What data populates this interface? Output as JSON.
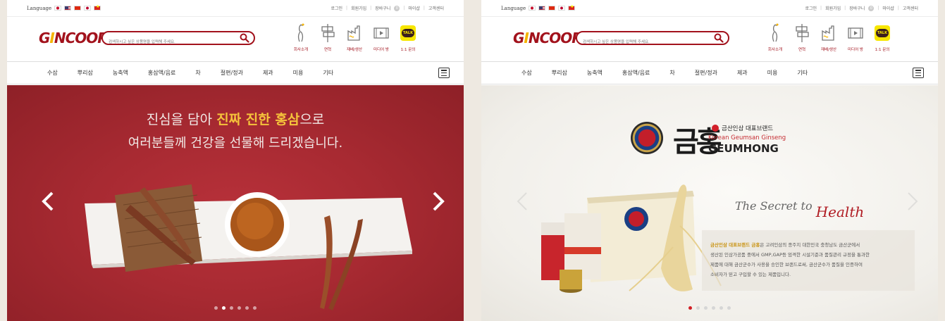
{
  "topbar": {
    "language_label": "Language",
    "links": [
      "로그인",
      "회원가입",
      "장바구니",
      "마이샵",
      "고객센터"
    ],
    "cart_count": "0"
  },
  "header": {
    "logo_text_before": "G",
    "logo_leaf": "I",
    "logo_text_after": "NCOOP",
    "search_placeholder": "검색하시고 싶은 상품명을 입력해 주세요.",
    "icons": [
      {
        "label": "회사소개",
        "icon": "ginseng-root-icon"
      },
      {
        "label": "연혁",
        "icon": "signpost-icon"
      },
      {
        "label": "재배/생산",
        "icon": "factory-icon"
      },
      {
        "label": "미디어 방",
        "icon": "film-play-icon"
      },
      {
        "label": "1:1 문의",
        "icon": "kakao-talk-icon",
        "badge": "TALK"
      }
    ]
  },
  "menu": {
    "items": [
      "수삼",
      "뿌리삼",
      "농축액",
      "홍삼액/음료",
      "차",
      "절편/정과",
      "제과",
      "미용",
      "기타"
    ]
  },
  "slide_left": {
    "line1_pre": "진심을 담아 ",
    "line1_highlight": "진짜 진한 홍삼",
    "line1_post": "으로",
    "line2": "여러분들께 건강을 선물해 드리겠습니다.",
    "dots": 6,
    "active_dot": 1
  },
  "slide_right": {
    "brand_han": "금홍",
    "brand_sub1": "금산인삼 대표브랜드",
    "brand_sub2": "Korean Geumsan Ginseng",
    "brand_sub3": "GEUMHONG",
    "secret_pre": "The Secret to",
    "secret_word": "Health",
    "desc_highlight": "금산인삼 대표브랜드 금홍",
    "desc_rest_1": "은 고려인삼의 종주지 대한민국 충청남도 금산군에서",
    "desc_line2": "생산된 인삼가공품 중에서 GMP,GAP등 엄격한 시설기준과 품질관리 규정을 통과한",
    "desc_line3": "제품에 대해 금산군수가 사용을 승인한 브랜드로써, 금산군수가 품질을 인증하여",
    "desc_line4": "소비자가 믿고 구입할 수 있는 제품입니다.",
    "dots": 6,
    "active_dot": 0
  },
  "colors": {
    "brand_red": "#a2121c",
    "highlight_gold": "#f5c33b",
    "kakao_yellow": "#f7e600"
  }
}
